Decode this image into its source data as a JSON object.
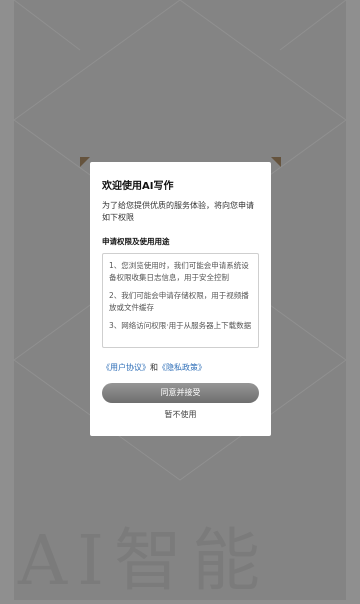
{
  "background": {
    "wordmark": "AI智能"
  },
  "dialog": {
    "title": "欢迎使用AI写作",
    "intro": "为了给您提供优质的服务体验，将向您申请如下权限",
    "section_title": "申请权限及使用用途",
    "permissions": [
      "1、您浏览使用时，我们可能会申请系统设备权限收集日志信息，用于安全控制",
      "2、我们可能会申请存储权限，用于视频播放或文件缓存",
      "3、网络访问权限·用于从服务器上下载数据"
    ],
    "user_agreement": "《用户协议》",
    "and": "和",
    "privacy_policy": "《隐私政策》",
    "agree_label": "同意并接受",
    "decline_label": "暂不使用"
  },
  "colors": {
    "link": "#2f6fb8",
    "button_top": "#969696",
    "button_bottom": "#6e6e6e",
    "accent_corner": "#6d5a42"
  }
}
